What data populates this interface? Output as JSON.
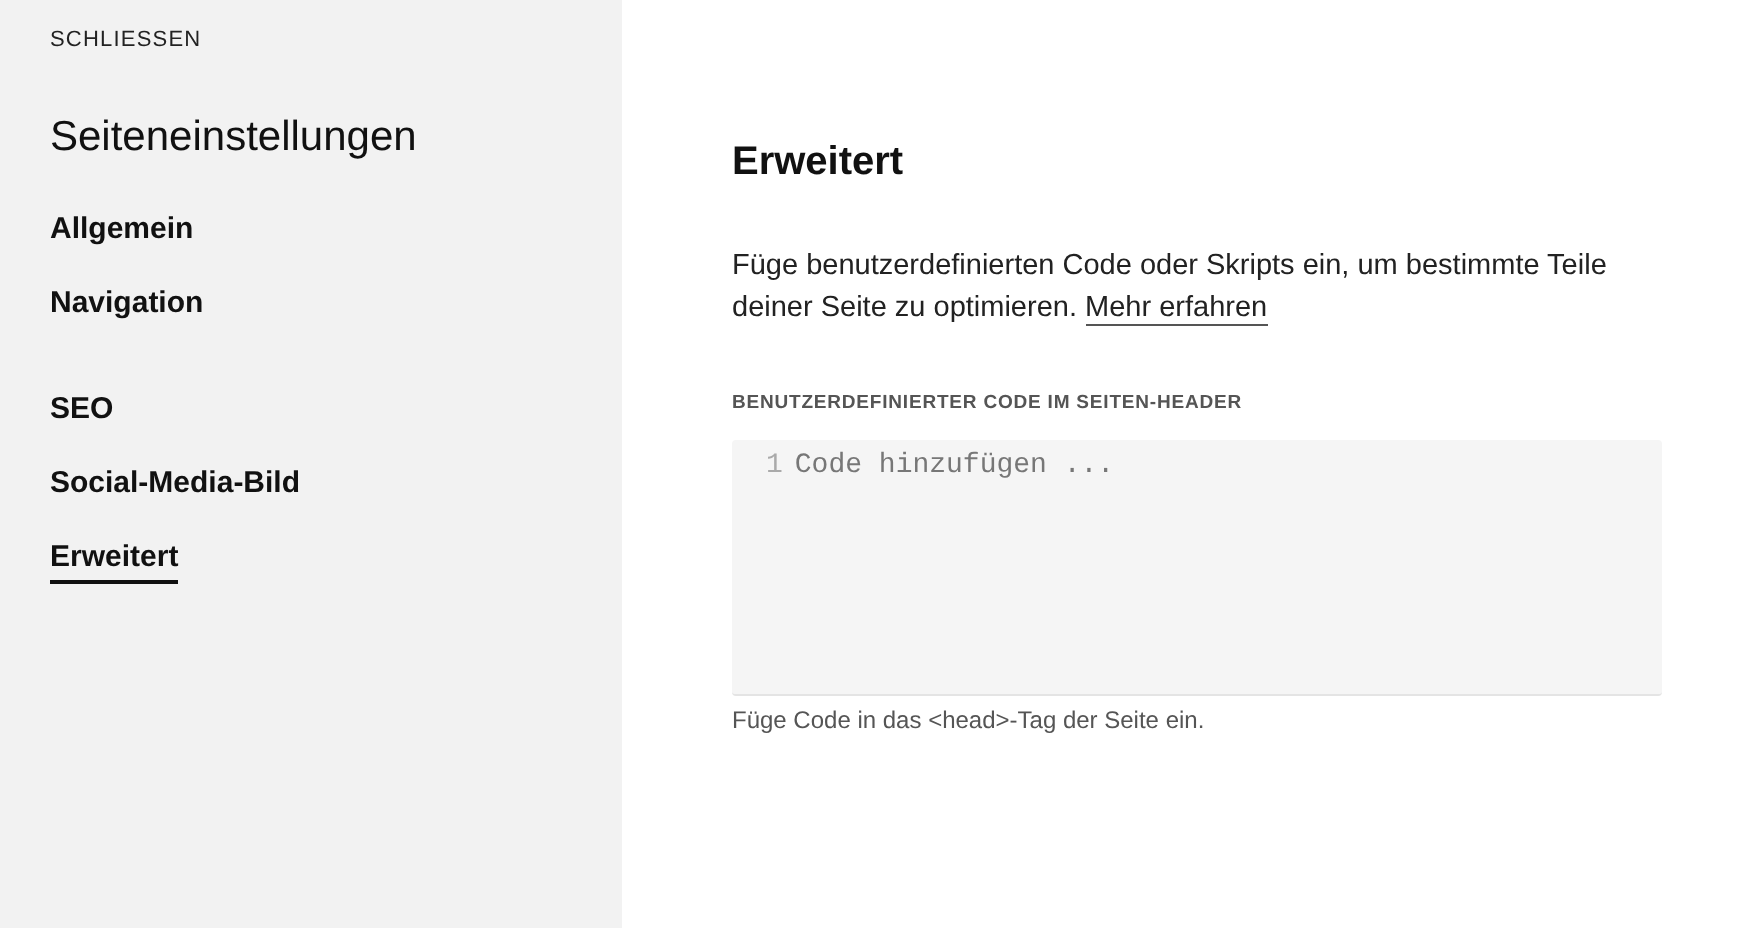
{
  "sidebar": {
    "close": "SCHLIESSEN",
    "title": "Seiteneinstellungen",
    "groups": [
      {
        "items": [
          {
            "label": "Allgemein",
            "selected": false
          },
          {
            "label": "Navigation",
            "selected": false
          }
        ]
      },
      {
        "items": [
          {
            "label": "SEO",
            "selected": false
          },
          {
            "label": "Social-Media-Bild",
            "selected": false
          },
          {
            "label": "Erweitert",
            "selected": true
          }
        ]
      }
    ]
  },
  "main": {
    "title": "Erweitert",
    "description": "Füge benutzerdefinierten Code oder Skripts ein, um bestimmte Teile deiner Seite zu optimieren.",
    "link": "Mehr erfahren",
    "field": {
      "label": "BENUTZERDEFINIERTER CODE IM SEITEN-HEADER",
      "line_number": "1",
      "placeholder": "Code hinzufügen ...",
      "help": "Füge Code in das <head>-Tag der Seite ein."
    }
  }
}
